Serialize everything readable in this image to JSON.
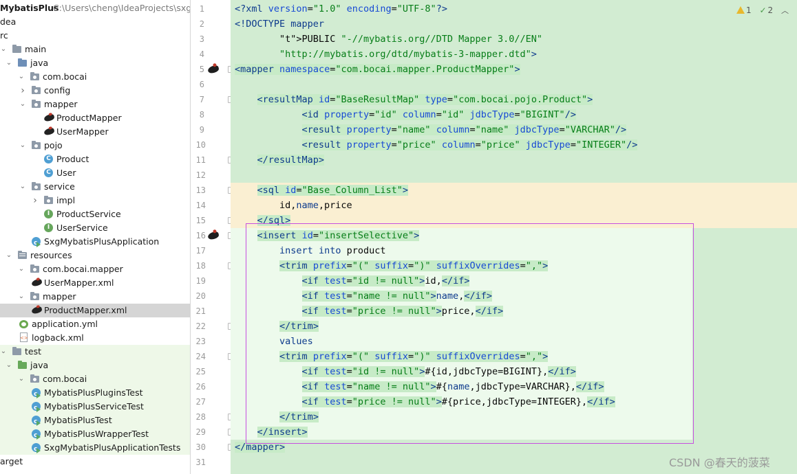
{
  "project": {
    "name": "MybatisPlus",
    "path": "C:\\Users\\cheng\\IdeaProjects\\sxgM"
  },
  "tree": [
    {
      "label": "dea",
      "arrow": "",
      "icon": "none"
    },
    {
      "label": "rc",
      "arrow": "",
      "icon": "none"
    },
    {
      "label": "main",
      "arrow": "down",
      "icon": "folder"
    },
    {
      "label": "java",
      "arrow": "down",
      "icon": "folder-src"
    },
    {
      "label": "com.bocai",
      "arrow": "down",
      "icon": "package"
    },
    {
      "label": "config",
      "arrow": "right",
      "icon": "package"
    },
    {
      "label": "mapper",
      "arrow": "down",
      "icon": "package"
    },
    {
      "label": "ProductMapper",
      "arrow": "",
      "icon": "mybatis-bird"
    },
    {
      "label": "UserMapper",
      "arrow": "",
      "icon": "mybatis-bird"
    },
    {
      "label": "pojo",
      "arrow": "down",
      "icon": "package"
    },
    {
      "label": "Product",
      "arrow": "",
      "icon": "class"
    },
    {
      "label": "User",
      "arrow": "",
      "icon": "class"
    },
    {
      "label": "service",
      "arrow": "down",
      "icon": "package"
    },
    {
      "label": "impl",
      "arrow": "right",
      "icon": "package"
    },
    {
      "label": "ProductService",
      "arrow": "",
      "icon": "interface"
    },
    {
      "label": "UserService",
      "arrow": "",
      "icon": "interface"
    },
    {
      "label": "SxgMybatisPlusApplication",
      "arrow": "",
      "icon": "spring-class"
    },
    {
      "label": "resources",
      "arrow": "down",
      "icon": "folder-res"
    },
    {
      "label": "com.bocai.mapper",
      "arrow": "down",
      "icon": "package"
    },
    {
      "label": "UserMapper.xml",
      "arrow": "",
      "icon": "mybatis-bird"
    },
    {
      "label": "mapper",
      "arrow": "down",
      "icon": "package"
    },
    {
      "label": "ProductMapper.xml",
      "arrow": "",
      "icon": "mybatis-bird"
    },
    {
      "label": "application.yml",
      "arrow": "",
      "icon": "yaml"
    },
    {
      "label": "logback.xml",
      "arrow": "",
      "icon": "xml"
    },
    {
      "label": "test",
      "arrow": "down",
      "icon": "folder"
    },
    {
      "label": "java",
      "arrow": "down",
      "icon": "folder-test"
    },
    {
      "label": "com.bocai",
      "arrow": "down",
      "icon": "package"
    },
    {
      "label": "MybatisPlusPluginsTest",
      "arrow": "",
      "icon": "test-class"
    },
    {
      "label": "MybatisPlusServiceTest",
      "arrow": "",
      "icon": "test-class"
    },
    {
      "label": "MybatisPlusTest",
      "arrow": "",
      "icon": "test-class"
    },
    {
      "label": "MybatisPlusWrapperTest",
      "arrow": "",
      "icon": "test-class"
    },
    {
      "label": "SxgMybatisPlusApplicationTests",
      "arrow": "",
      "icon": "test-class"
    },
    {
      "label": "arget",
      "arrow": "",
      "icon": "none"
    }
  ],
  "selected_file": "ProductMapper.xml",
  "inspection": {
    "warnings": "1",
    "weak_warnings": "2"
  },
  "code_lines": [
    "<?xml version=\"1.0\" encoding=\"UTF-8\"?>",
    "<!DOCTYPE mapper",
    "        PUBLIC \"-//mybatis.org//DTD Mapper 3.0//EN\"",
    "        \"http://mybatis.org/dtd/mybatis-3-mapper.dtd\">",
    "<mapper namespace=\"com.bocai.mapper.ProductMapper\">",
    "",
    "    <resultMap id=\"BaseResultMap\" type=\"com.bocai.pojo.Product\">",
    "            <id property=\"id\" column=\"id\" jdbcType=\"BIGINT\"/>",
    "            <result property=\"name\" column=\"name\" jdbcType=\"VARCHAR\"/>",
    "            <result property=\"price\" column=\"price\" jdbcType=\"INTEGER\"/>",
    "    </resultMap>",
    "",
    "    <sql id=\"Base_Column_List\">",
    "        id,name,price",
    "    </sql>",
    "    <insert id=\"insertSelective\">",
    "        insert into product",
    "        <trim prefix=\"(\" suffix=\")\" suffixOverrides=\",\">",
    "            <if test=\"id != null\">id,</if>",
    "            <if test=\"name != null\">name,</if>",
    "            <if test=\"price != null\">price,</if>",
    "        </trim>",
    "        values",
    "        <trim prefix=\"(\" suffix=\")\" suffixOverrides=\",\">",
    "            <if test=\"id != null\">#{id,jdbcType=BIGINT},</if>",
    "            <if test=\"name != null\">#{name,jdbcType=VARCHAR},</if>",
    "            <if test=\"price != null\">#{price,jdbcType=INTEGER},</if>",
    "        </trim>",
    "    </insert>",
    "</mapper>",
    ""
  ],
  "watermark": "CSDN @春天的菠菜",
  "colors": {
    "editor_bg": "#d2ecd2",
    "sql_highlight": "#faefd2",
    "insert_highlight": "#edfaec",
    "selection_box": "#c64fe0",
    "tag": "#0d3a8c",
    "attribute": "#174ad4",
    "string": "#067d17"
  }
}
